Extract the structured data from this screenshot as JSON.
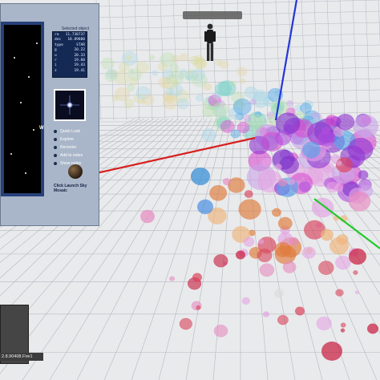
{
  "scene": {
    "avatar_name_tag": "",
    "colors": {
      "background": "#e9eaec",
      "grid": "#b5b8c0",
      "x_axis": "#d81e1e",
      "y_axis": "#2436d6",
      "z_axis": "#22c82a"
    }
  },
  "sky_panel": {
    "title": "Selected object",
    "compass_letter": "W",
    "info": [
      {
        "k": "ra",
        "v": "11.738737"
      },
      {
        "k": "dec",
        "v": "18.89880"
      },
      {
        "k": "type",
        "v": "STAR"
      },
      {
        "k": "g",
        "v": "20.22"
      },
      {
        "k": "u",
        "v": "20.33"
      },
      {
        "k": "r",
        "v": "19.60"
      },
      {
        "k": "i",
        "v": "19.43"
      },
      {
        "k": "z",
        "v": "19.41"
      }
    ],
    "actions": [
      {
        "label": "Quick Look"
      },
      {
        "label": "Explore"
      },
      {
        "label": "Recenter"
      },
      {
        "label": "Add to notes"
      },
      {
        "label": "Show notes"
      }
    ],
    "click_label": "Click Launch Sky Mosaic",
    "blurb": ""
  },
  "dock": {
    "url": "2.8.90408.Fire1"
  }
}
